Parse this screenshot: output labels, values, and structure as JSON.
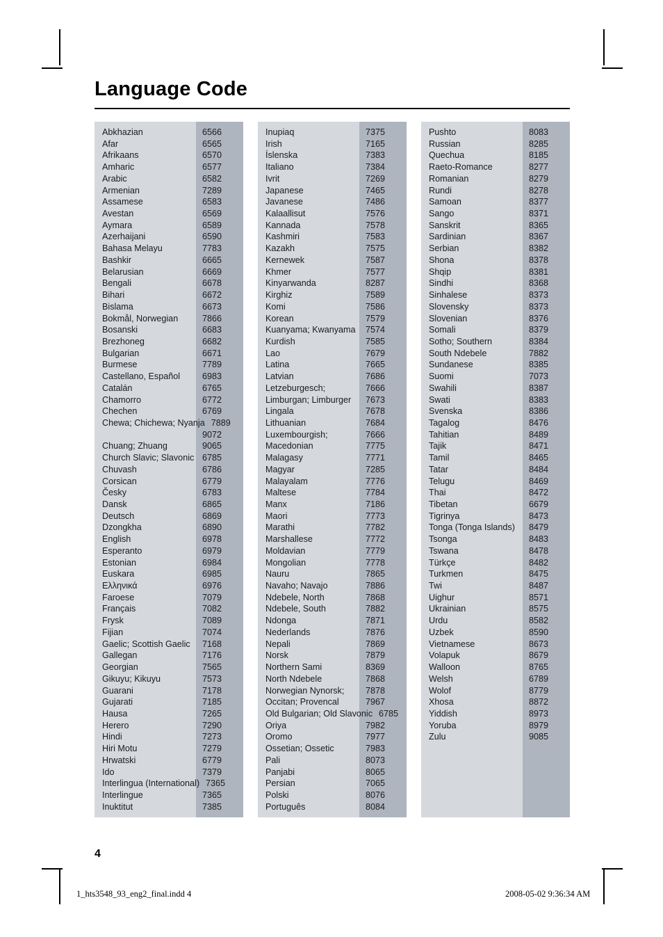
{
  "page": {
    "title": "Language Code",
    "page_number": "4"
  },
  "footer": {
    "file_name": "1_hts3548_93_eng2_final.indd   4",
    "timestamp": "2008-05-02   9:36:34 AM"
  },
  "colors": {
    "name_band": "#d5d8dd",
    "code_band": "#aeb5bf",
    "text": "#1a1a1a",
    "rule": "#000000"
  },
  "columns": [
    {
      "rows": [
        {
          "language": "Abkhazian",
          "code": "6566"
        },
        {
          "language": "Afar",
          "code": "6565"
        },
        {
          "language": "Afrikaans",
          "code": "6570"
        },
        {
          "language": "Amharic",
          "code": "6577"
        },
        {
          "language": "Arabic",
          "code": "6582"
        },
        {
          "language": "Armenian",
          "code": "7289"
        },
        {
          "language": "Assamese",
          "code": "6583"
        },
        {
          "language": "Avestan",
          "code": "6569"
        },
        {
          "language": "Aymara",
          "code": "6589"
        },
        {
          "language": "Azerhaijani",
          "code": "6590"
        },
        {
          "language": "Bahasa Melayu",
          "code": "7783"
        },
        {
          "language": "Bashkir",
          "code": "6665"
        },
        {
          "language": "Belarusian",
          "code": "6669"
        },
        {
          "language": "Bengali",
          "code": "6678"
        },
        {
          "language": "Bihari",
          "code": "6672"
        },
        {
          "language": "Bislama",
          "code": "6673"
        },
        {
          "language": "Bokmål, Norwegian",
          "code": "7866"
        },
        {
          "language": "Bosanski",
          "code": "6683"
        },
        {
          "language": "Brezhoneg",
          "code": "6682"
        },
        {
          "language": "Bulgarian",
          "code": "6671"
        },
        {
          "language": "Burmese",
          "code": "7789"
        },
        {
          "language": "Castellano, Español",
          "code": "6983"
        },
        {
          "language": "Catalán",
          "code": "6765"
        },
        {
          "language": "Chamorro",
          "code": "6772"
        },
        {
          "language": "Chechen",
          "code": "6769"
        },
        {
          "language": "Chewa; Chichewa; Nyanja",
          "code": "7889"
        },
        {
          "language": "",
          "code": "9072"
        },
        {
          "language": "Chuang; Zhuang",
          "code": "9065"
        },
        {
          "language": "Church Slavic; Slavonic",
          "code": "6785"
        },
        {
          "language": "Chuvash",
          "code": "6786"
        },
        {
          "language": "Corsican",
          "code": "6779"
        },
        {
          "language": "Česky",
          "code": "6783"
        },
        {
          "language": "Dansk",
          "code": "6865"
        },
        {
          "language": "Deutsch",
          "code": "6869"
        },
        {
          "language": "Dzongkha",
          "code": "6890"
        },
        {
          "language": "English",
          "code": "6978"
        },
        {
          "language": "Esperanto",
          "code": "6979"
        },
        {
          "language": "Estonian",
          "code": "6984"
        },
        {
          "language": "Euskara",
          "code": "6985"
        },
        {
          "language": "Ελληνικά",
          "code": "6976"
        },
        {
          "language": "Faroese",
          "code": "7079"
        },
        {
          "language": "Français",
          "code": "7082"
        },
        {
          "language": "Frysk",
          "code": "7089"
        },
        {
          "language": "Fijian",
          "code": "7074"
        },
        {
          "language": "Gaelic; Scottish Gaelic",
          "code": "7168"
        },
        {
          "language": "Gallegan",
          "code": "7176"
        },
        {
          "language": "Georgian",
          "code": "7565"
        },
        {
          "language": "Gikuyu; Kikuyu",
          "code": "7573"
        },
        {
          "language": "Guarani",
          "code": "7178"
        },
        {
          "language": "Gujarati",
          "code": "7185"
        },
        {
          "language": "Hausa",
          "code": "7265"
        },
        {
          "language": "Herero",
          "code": "7290"
        },
        {
          "language": "Hindi",
          "code": "7273"
        },
        {
          "language": "Hiri Motu",
          "code": "7279"
        },
        {
          "language": "Hrwatski",
          "code": "6779"
        },
        {
          "language": "Ido",
          "code": "7379"
        },
        {
          "language": "Interlingua (International)",
          "code": "7365"
        },
        {
          "language": "Interlingue",
          "code": "7365"
        },
        {
          "language": "Inuktitut",
          "code": "7385"
        }
      ]
    },
    {
      "rows": [
        {
          "language": "Inupiaq",
          "code": "7375"
        },
        {
          "language": "Irish",
          "code": "7165"
        },
        {
          "language": "Íslenska",
          "code": "7383"
        },
        {
          "language": "Italiano",
          "code": "7384"
        },
        {
          "language": "Ivrit",
          "code": "7269"
        },
        {
          "language": "Japanese",
          "code": "7465"
        },
        {
          "language": "Javanese",
          "code": "7486"
        },
        {
          "language": "Kalaallisut",
          "code": "7576"
        },
        {
          "language": "Kannada",
          "code": "7578"
        },
        {
          "language": "Kashmiri",
          "code": "7583"
        },
        {
          "language": "Kazakh",
          "code": "7575"
        },
        {
          "language": "Kernewek",
          "code": "7587"
        },
        {
          "language": "Khmer",
          "code": "7577"
        },
        {
          "language": "Kinyarwanda",
          "code": "8287"
        },
        {
          "language": "Kirghiz",
          "code": "7589"
        },
        {
          "language": "Komi",
          "code": "7586"
        },
        {
          "language": "Korean",
          "code": "7579"
        },
        {
          "language": "Kuanyama; Kwanyama",
          "code": "7574"
        },
        {
          "language": "Kurdish",
          "code": "7585"
        },
        {
          "language": "Lao",
          "code": "7679"
        },
        {
          "language": "Latina",
          "code": "7665"
        },
        {
          "language": "Latvian",
          "code": "7686"
        },
        {
          "language": "Letzeburgesch;",
          "code": "7666"
        },
        {
          "language": "Limburgan; Limburger",
          "code": "7673"
        },
        {
          "language": "Lingala",
          "code": "7678"
        },
        {
          "language": "Lithuanian",
          "code": "7684"
        },
        {
          "language": "Luxembourgish;",
          "code": "7666"
        },
        {
          "language": "Macedonian",
          "code": "7775"
        },
        {
          "language": "Malagasy",
          "code": "7771"
        },
        {
          "language": "Magyar",
          "code": "7285"
        },
        {
          "language": "Malayalam",
          "code": "7776"
        },
        {
          "language": "Maltese",
          "code": "7784"
        },
        {
          "language": "Manx",
          "code": "7186"
        },
        {
          "language": "Maori",
          "code": "7773"
        },
        {
          "language": "Marathi",
          "code": "7782"
        },
        {
          "language": "Marshallese",
          "code": "7772"
        },
        {
          "language": "Moldavian",
          "code": "7779"
        },
        {
          "language": "Mongolian",
          "code": "7778"
        },
        {
          "language": "Nauru",
          "code": "7865"
        },
        {
          "language": "Navaho; Navajo",
          "code": "7886"
        },
        {
          "language": "Ndebele, North",
          "code": "7868"
        },
        {
          "language": "Ndebele, South",
          "code": "7882"
        },
        {
          "language": "Ndonga",
          "code": "7871"
        },
        {
          "language": "Nederlands",
          "code": "7876"
        },
        {
          "language": "Nepali",
          "code": "7869"
        },
        {
          "language": "Norsk",
          "code": "7879"
        },
        {
          "language": "Northern Sami",
          "code": "8369"
        },
        {
          "language": "North Ndebele",
          "code": "7868"
        },
        {
          "language": "Norwegian Nynorsk;",
          "code": "7878"
        },
        {
          "language": "Occitan; Provencal",
          "code": "7967"
        },
        {
          "language": "Old Bulgarian; Old Slavonic",
          "code": "6785"
        },
        {
          "language": "Oriya",
          "code": "7982"
        },
        {
          "language": "Oromo",
          "code": "7977"
        },
        {
          "language": "Ossetian; Ossetic",
          "code": "7983"
        },
        {
          "language": "Pali",
          "code": "8073"
        },
        {
          "language": "Panjabi",
          "code": "8065"
        },
        {
          "language": "Persian",
          "code": "7065"
        },
        {
          "language": "Polski",
          "code": "8076"
        },
        {
          "language": "Português",
          "code": "8084"
        }
      ]
    },
    {
      "rows": [
        {
          "language": "Pushto",
          "code": "8083"
        },
        {
          "language": "Russian",
          "code": "8285"
        },
        {
          "language": "Quechua",
          "code": "8185"
        },
        {
          "language": "Raeto-Romance",
          "code": "8277"
        },
        {
          "language": "Romanian",
          "code": "8279"
        },
        {
          "language": "Rundi",
          "code": "8278"
        },
        {
          "language": "Samoan",
          "code": "8377"
        },
        {
          "language": "Sango",
          "code": "8371"
        },
        {
          "language": "Sanskrit",
          "code": "8365"
        },
        {
          "language": "Sardinian",
          "code": "8367"
        },
        {
          "language": "Serbian",
          "code": "8382"
        },
        {
          "language": "Shona",
          "code": "8378"
        },
        {
          "language": "Shqip",
          "code": "8381"
        },
        {
          "language": "Sindhi",
          "code": "8368"
        },
        {
          "language": "Sinhalese",
          "code": "8373"
        },
        {
          "language": "Slovensky",
          "code": "8373"
        },
        {
          "language": "Slovenian",
          "code": "8376"
        },
        {
          "language": "Somali",
          "code": "8379"
        },
        {
          "language": "Sotho; Southern",
          "code": "8384"
        },
        {
          "language": "South Ndebele",
          "code": "7882"
        },
        {
          "language": "Sundanese",
          "code": "8385"
        },
        {
          "language": "Suomi",
          "code": "7073"
        },
        {
          "language": "Swahili",
          "code": "8387"
        },
        {
          "language": "Swati",
          "code": "8383"
        },
        {
          "language": "Svenska",
          "code": "8386"
        },
        {
          "language": "Tagalog",
          "code": "8476"
        },
        {
          "language": "Tahitian",
          "code": "8489"
        },
        {
          "language": "Tajik",
          "code": "8471"
        },
        {
          "language": "Tamil",
          "code": "8465"
        },
        {
          "language": "Tatar",
          "code": "8484"
        },
        {
          "language": "Telugu",
          "code": "8469"
        },
        {
          "language": "Thai",
          "code": "8472"
        },
        {
          "language": "Tibetan",
          "code": "6679"
        },
        {
          "language": "Tigrinya",
          "code": "8473"
        },
        {
          "language": "Tonga (Tonga Islands)",
          "code": "8479"
        },
        {
          "language": "Tsonga",
          "code": "8483"
        },
        {
          "language": "Tswana",
          "code": "8478"
        },
        {
          "language": "Türkçe",
          "code": "8482"
        },
        {
          "language": "Turkmen",
          "code": "8475"
        },
        {
          "language": "Twi",
          "code": "8487"
        },
        {
          "language": "Uighur",
          "code": "8571"
        },
        {
          "language": "Ukrainian",
          "code": "8575"
        },
        {
          "language": "Urdu",
          "code": "8582"
        },
        {
          "language": "Uzbek",
          "code": "8590"
        },
        {
          "language": "Vietnamese",
          "code": "8673"
        },
        {
          "language": "Volapuk",
          "code": "8679"
        },
        {
          "language": "Walloon",
          "code": "8765"
        },
        {
          "language": "Welsh",
          "code": "6789"
        },
        {
          "language": "Wolof",
          "code": "8779"
        },
        {
          "language": "Xhosa",
          "code": "8872"
        },
        {
          "language": "Yiddish",
          "code": "8973"
        },
        {
          "language": "Yoruba",
          "code": "8979"
        },
        {
          "language": "Zulu",
          "code": "9085"
        },
        {
          "language": "",
          "code": ""
        },
        {
          "language": "",
          "code": ""
        },
        {
          "language": "",
          "code": ""
        },
        {
          "language": "",
          "code": ""
        },
        {
          "language": "",
          "code": ""
        },
        {
          "language": "",
          "code": ""
        }
      ]
    }
  ]
}
